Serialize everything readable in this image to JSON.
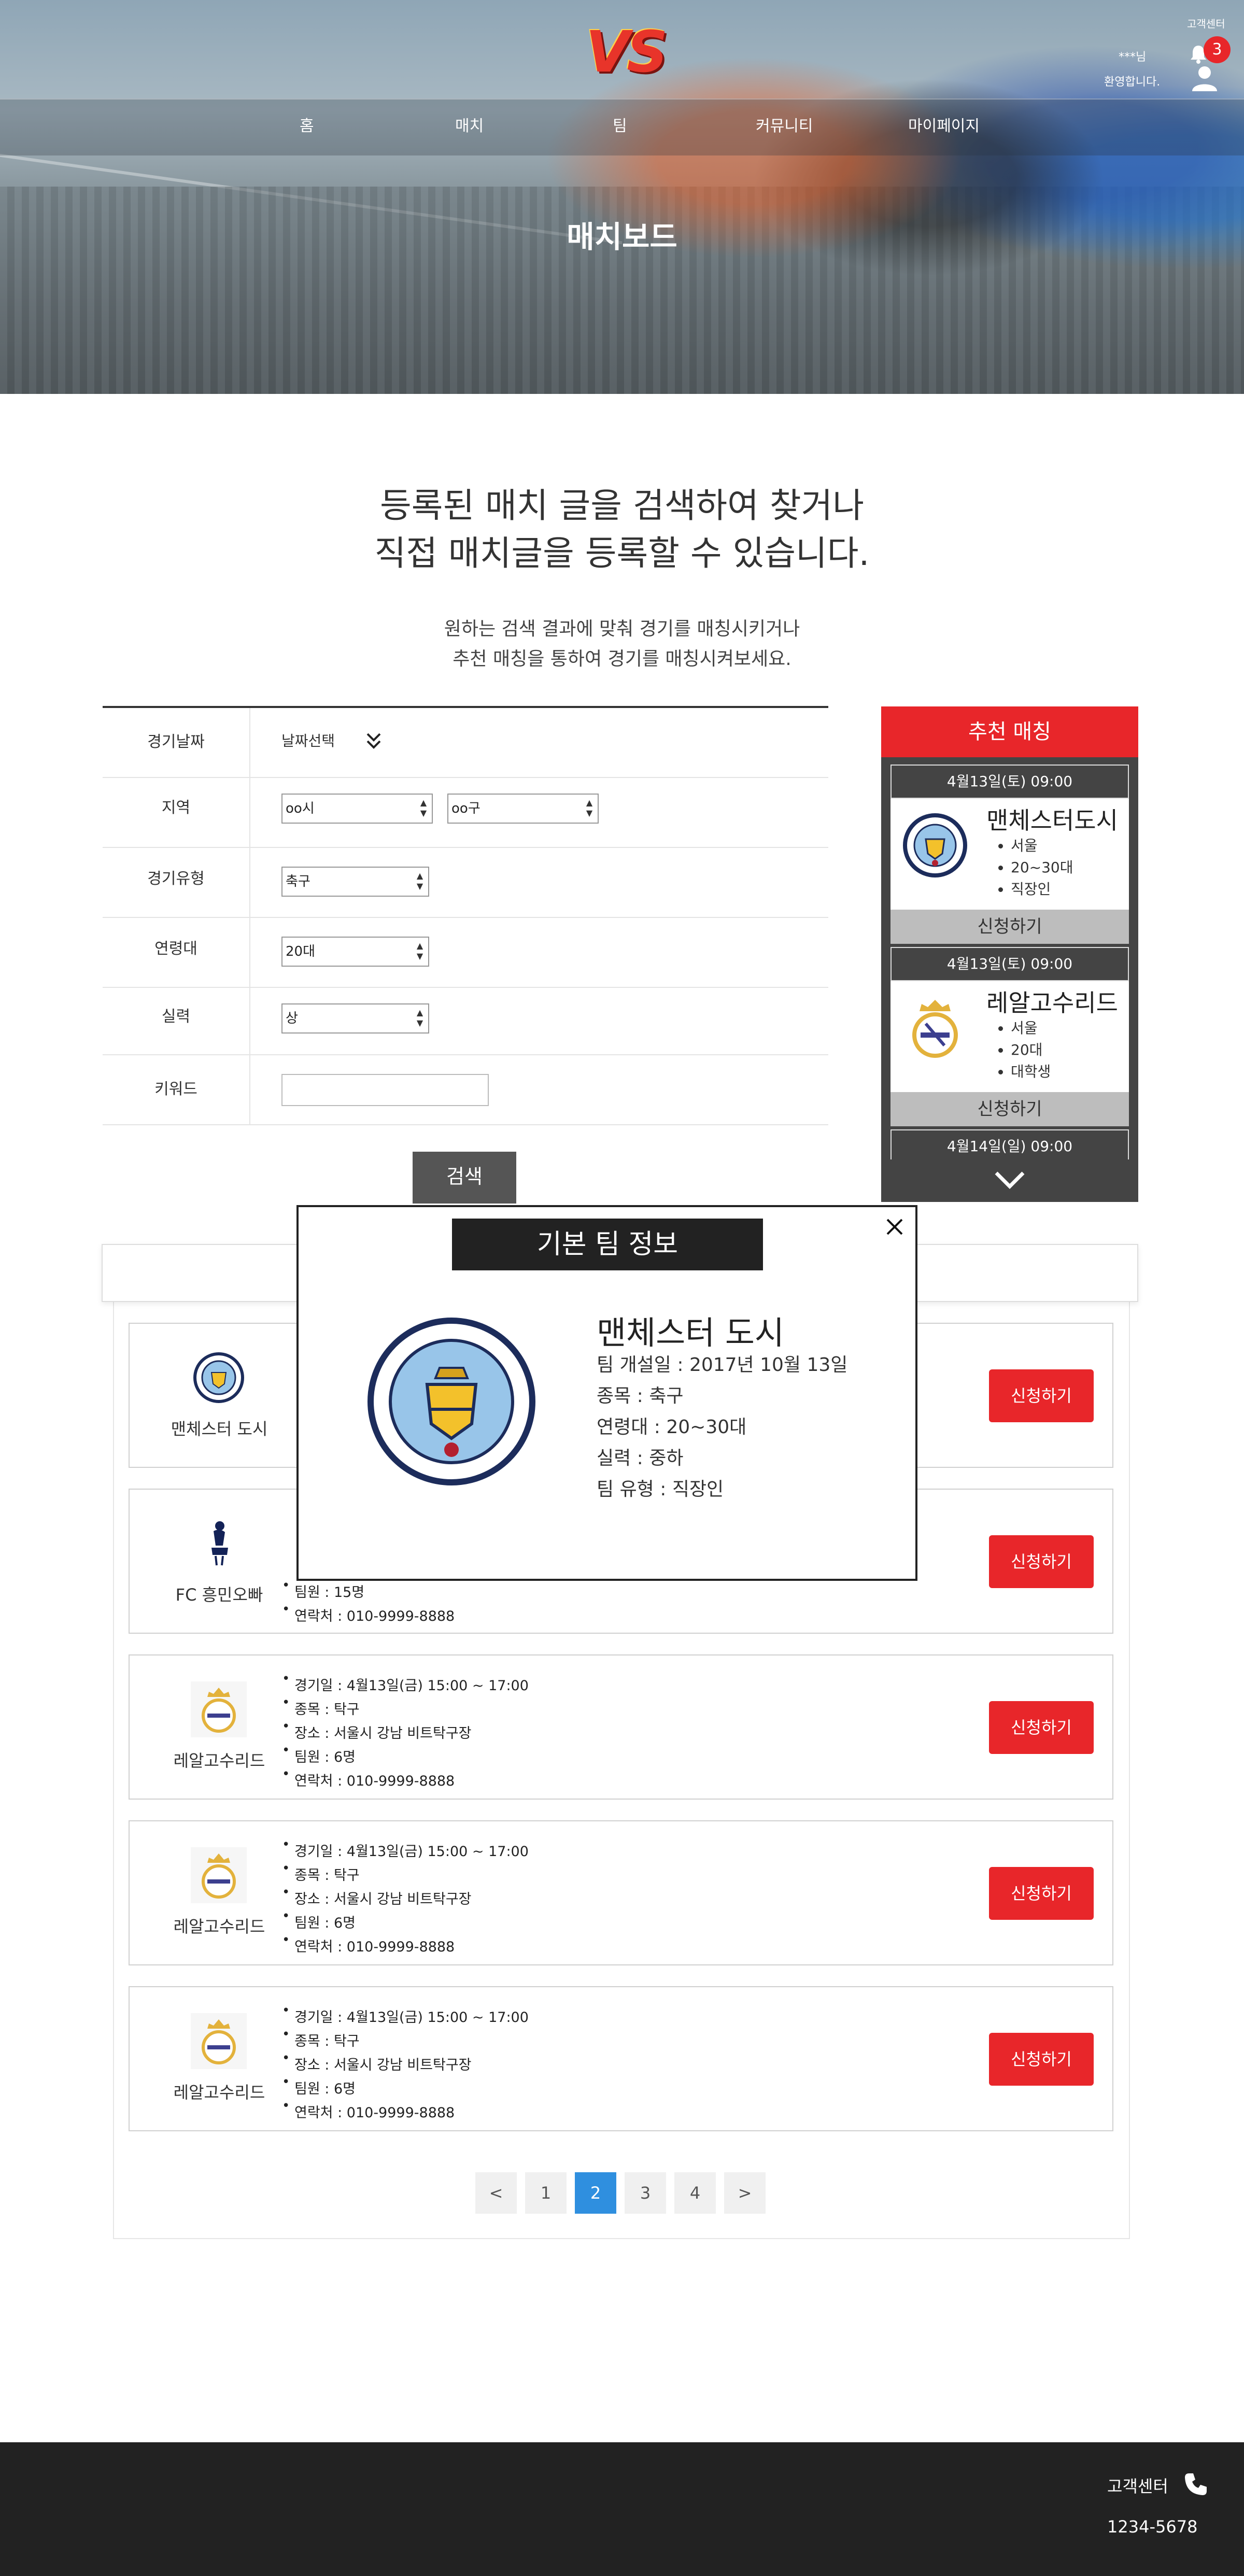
{
  "header": {
    "logo_text": "VS",
    "nav": [
      "홈",
      "매치",
      "팀",
      "커뮤니티",
      "마이페이지"
    ],
    "top_link": "고객센터",
    "user_line1": "***님",
    "user_line2": "환영합니다.",
    "notification_count": "3",
    "page_title": "매치보드"
  },
  "intro": {
    "heading_line1": "등록된 매치 글을 검색하여 찾거나",
    "heading_line2": "직접 매치글을 등록할 수 있습니다.",
    "sub_line1": "원하는 검색 결과에 맞춰 경기를 매칭시키거나",
    "sub_line2": "추천 매칭을 통하여 경기를 매칭시켜보세요."
  },
  "search_form": {
    "date": {
      "label": "경기날짜",
      "value": "날짜선택"
    },
    "region": {
      "label": "지역",
      "city": "oo시",
      "district": "oo구"
    },
    "match_type": {
      "label": "경기유형",
      "value": "축구"
    },
    "age": {
      "label": "연령대",
      "value": "20대"
    },
    "skill": {
      "label": "실력",
      "value": "상"
    },
    "keyword": {
      "label": "키워드",
      "value": ""
    },
    "search_button": "검색"
  },
  "recommend": {
    "title": "추천 매칭",
    "cards": [
      {
        "datetime": "4월13일(토) 09:00",
        "team": "맨체스터도시",
        "details": [
          "서울",
          "20~30대",
          "직장인"
        ],
        "apply": "신청하기"
      },
      {
        "datetime": "4월13일(토) 09:00",
        "team": "레알고수리드",
        "details": [
          "서울",
          "20대",
          "대학생"
        ],
        "apply": "신청하기"
      },
      {
        "datetime": "4월14일(일) 09:00"
      }
    ]
  },
  "match_list": [
    {
      "team": "맨체스터 도시",
      "emblem": "man-city-emblem",
      "details": [],
      "apply": "신청하기"
    },
    {
      "team": "FC 흥민오빠",
      "emblem": "tottenham-emblem",
      "details": [
        "팀원 : 15명",
        "연락처 : 010-9999-8888"
      ],
      "apply": "신청하기"
    },
    {
      "team": "레알고수리드",
      "emblem": "real-madrid-emblem",
      "details": [
        "경기일 : 4월13일(금) 15:00 ~ 17:00",
        "종목 : 탁구",
        "장소 : 서울시 강남 비트탁구장",
        "팀원 : 6명",
        "연락처 : 010-9999-8888"
      ],
      "apply": "신청하기"
    },
    {
      "team": "레알고수리드",
      "emblem": "real-madrid-emblem",
      "details": [
        "경기일 : 4월13일(금) 15:00 ~ 17:00",
        "종목 : 탁구",
        "장소 : 서울시 강남 비트탁구장",
        "팀원 : 6명",
        "연락처 : 010-9999-8888"
      ],
      "apply": "신청하기"
    },
    {
      "team": "레알고수리드",
      "emblem": "real-madrid-emblem",
      "details": [
        "경기일 : 4월13일(금) 15:00 ~ 17:00",
        "종목 : 탁구",
        "장소 : 서울시 강남 비트탁구장",
        "팀원 : 6명",
        "연락처 : 010-9999-8888"
      ],
      "apply": "신청하기"
    }
  ],
  "pagination": {
    "prev": "<",
    "pages": [
      "1",
      "2",
      "3",
      "4"
    ],
    "current": "2",
    "next": ">"
  },
  "modal": {
    "title": "기본 팀 정보",
    "team_name": "맨체스터 도시",
    "info": [
      "팀 개설일 : 2017년 10월 13일",
      "종목 : 축구",
      "연령대 : 20~30대",
      "실력 : 중하",
      "팀 유형 : 직장인"
    ]
  },
  "footer": {
    "customer_center": "고객센터",
    "phone": "1234-5678"
  },
  "colors": {
    "accent_red": "#e8262a",
    "dark": "#444444",
    "page_active": "#2f8fdf"
  }
}
